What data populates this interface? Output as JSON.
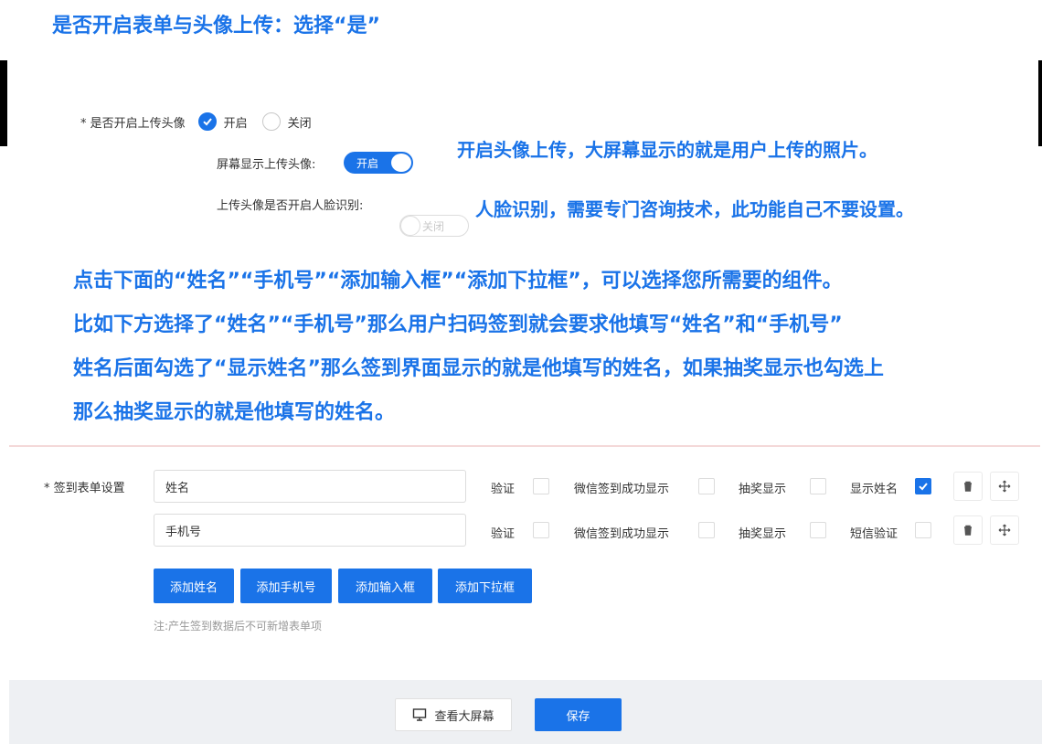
{
  "heading": "是否开启表单与头像上传：选择“是”",
  "avatar_upload": {
    "label": "* 是否开启上传头像",
    "options": [
      "开启",
      "关闭"
    ],
    "selected": "开启"
  },
  "screen_display": {
    "label": "屏幕显示上传头像:",
    "switch_text": "开启",
    "state": "on"
  },
  "face_recognition": {
    "label": "上传头像是否开启人脸识别:",
    "switch_text": "关闭",
    "state": "off"
  },
  "notes": {
    "avatar_note": "开启头像上传，大屏幕显示的就是用户上传的照片。",
    "face_note": "人脸识别，需要专门咨询技术，此功能自己不要设置。",
    "instructions": [
      "点击下面的“姓名”“手机号”“添加输入框”“添加下拉框”，可以选择您所需要的组件。",
      "比如下方选择了“姓名”“手机号”那么用户扫码签到就会要求他填写“姓名”和“手机号”",
      "姓名后面勾选了“显示姓名”那么签到界面显示的就是他填写的姓名，如果抽奖显示也勾选上",
      "那么抽奖显示的就是他填写的姓名。"
    ]
  },
  "form_settings": {
    "label": "* 签到表单设置",
    "rows": [
      {
        "value": "姓名",
        "verify_label": "验证",
        "verify": false,
        "wechat_label": "微信签到成功显示",
        "wechat": false,
        "lottery_label": "抽奖显示",
        "lottery": false,
        "extra_label": "显示姓名",
        "extra": true
      },
      {
        "value": "手机号",
        "verify_label": "验证",
        "verify": false,
        "wechat_label": "微信签到成功显示",
        "wechat": false,
        "lottery_label": "抽奖显示",
        "lottery": false,
        "extra_label": "短信验证",
        "extra": false
      }
    ],
    "add_buttons": [
      "添加姓名",
      "添加手机号",
      "添加输入框",
      "添加下拉框"
    ],
    "footnote": "注:产生签到数据后不可新增表单项"
  },
  "footer": {
    "view_screen": "查看大屏幕",
    "save": "保存"
  },
  "colors": {
    "accent": "#1a73e8",
    "footer_bg": "#eef0f3",
    "divider": "#f4d9d9"
  },
  "icons": {
    "delete": "trash-icon",
    "move": "move-icon",
    "monitor": "monitor-icon",
    "check": "check-icon"
  }
}
